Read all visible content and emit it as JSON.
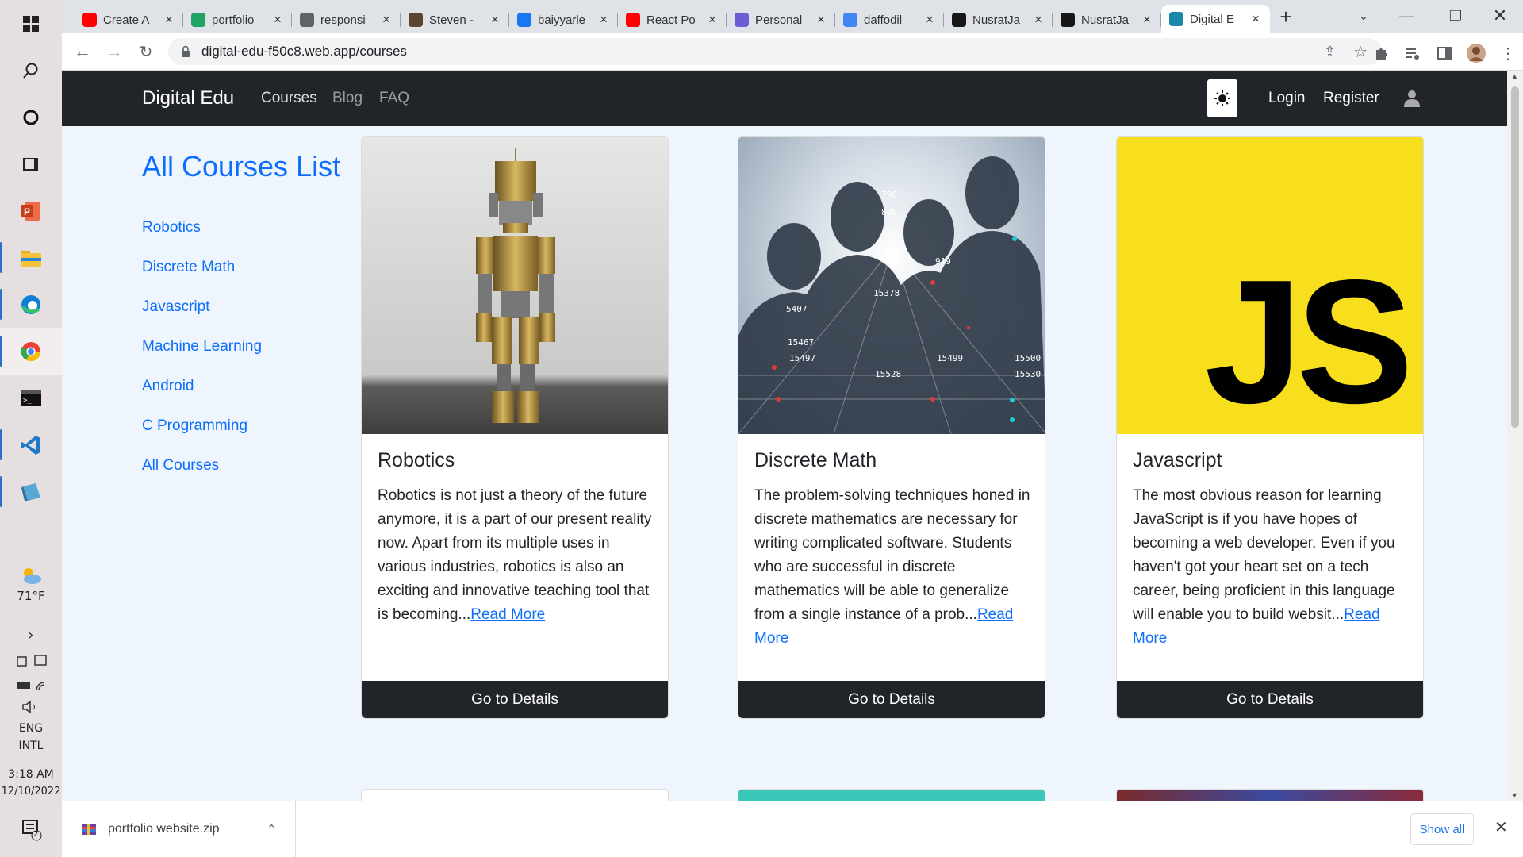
{
  "taskbar": {
    "weather_temp": "71°F",
    "lang_line1": "ENG",
    "lang_line2": "INTL",
    "time": "3:18 AM",
    "date": "12/10/2022",
    "notification_count": "2"
  },
  "tabs": [
    {
      "title": "Create A",
      "icon": "youtube-icon",
      "color": "#ff0000"
    },
    {
      "title": "portfolio",
      "icon": "google-drive-icon",
      "color": "#1fa463"
    },
    {
      "title": "responsi",
      "icon": "globe-icon",
      "color": "#5f6368"
    },
    {
      "title": "Steven -",
      "icon": "page-icon",
      "color": "#5a4630"
    },
    {
      "title": "baiyyarle",
      "icon": "facebook-icon",
      "color": "#1877f2"
    },
    {
      "title": "React Po",
      "icon": "youtube-icon",
      "color": "#ff0000"
    },
    {
      "title": "Personal",
      "icon": "m-logo-icon",
      "color": "#6e5bd6"
    },
    {
      "title": "daffodil",
      "icon": "google-icon",
      "color": "#4285f4"
    },
    {
      "title": "NusratJa",
      "icon": "github-icon",
      "color": "#181717"
    },
    {
      "title": "NusratJa",
      "icon": "github-icon",
      "color": "#181717"
    },
    {
      "title": "Digital E",
      "icon": "site-icon",
      "color": "#1e88a8"
    }
  ],
  "browser": {
    "url": "digital-edu-f50c8.web.app/courses"
  },
  "header": {
    "brand": "Digital Edu",
    "nav": [
      "Courses",
      "Blog",
      "FAQ"
    ],
    "login": "Login",
    "register": "Register"
  },
  "sidebar": {
    "title": "All Courses List",
    "links": [
      "Robotics",
      "Discrete Math",
      "Javascript",
      "Machine Learning",
      "Android",
      "C Programming",
      "All Courses"
    ]
  },
  "cards": [
    {
      "title": "Robotics",
      "desc": "Robotics is not just a theory of the future anymore, it is a part of our present reality now. Apart from its multiple uses in various industries, robotics is also an exciting and innovative teaching tool that is becoming...",
      "read_more": "Read More",
      "button": "Go to Details"
    },
    {
      "title": "Discrete Math",
      "desc": "The problem-solving techniques honed in discrete mathematics are necessary for writing complicated software. Students who are successful in discrete mathematics will be able to generalize from a single instance of a prob...",
      "read_more": "Read More",
      "button": "Go to Details"
    },
    {
      "title": "Javascript",
      "desc": "The most obvious reason for learning JavaScript is if you have hopes of becoming a web developer. Even if you haven't got your heart set on a tech career, being proficient in this language will enable you to build websit...",
      "read_more": "Read More",
      "button": "Go to Details"
    }
  ],
  "js_logo": "JS",
  "discrete_numbers": [
    "798",
    "826",
    "919",
    "15378",
    "5407",
    "15467",
    "15497",
    "15499",
    "15500",
    "15528",
    "15530"
  ],
  "download": {
    "filename": "portfolio website.zip",
    "show_all": "Show all"
  },
  "colors": {
    "accent": "#0d6efd",
    "dark": "#212529",
    "page_bg": "#eef5fc",
    "js_yellow": "#f7df1e"
  }
}
